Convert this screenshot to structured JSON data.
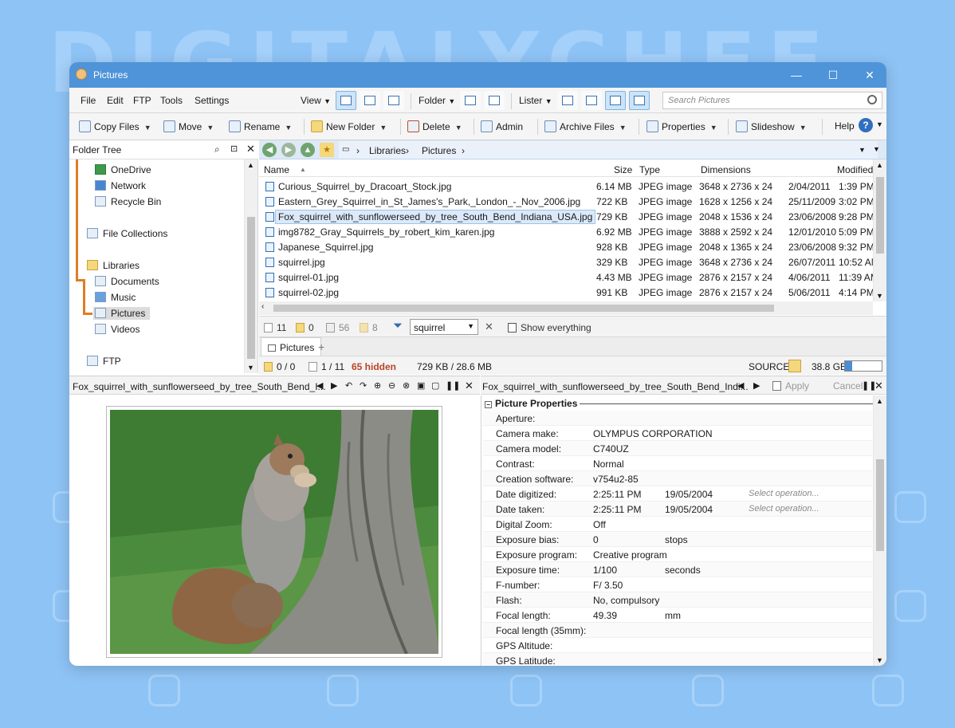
{
  "background": {
    "brand": "DIGITALYCHEF",
    "color": "#8ec3f5"
  },
  "window": {
    "title": "Pictures",
    "accent": "#4f93d8"
  },
  "menu": {
    "file": "File",
    "edit": "Edit",
    "ftp": "FTP",
    "tools": "Tools",
    "settings": "Settings",
    "view": "View",
    "folder": "Folder",
    "lister": "Lister",
    "search_placeholder": "Search Pictures"
  },
  "toolbar": {
    "copy": "Copy Files",
    "move": "Move",
    "rename": "Rename",
    "new_folder": "New Folder",
    "delete": "Delete",
    "admin": "Admin",
    "archive": "Archive Files",
    "properties": "Properties",
    "slideshow": "Slideshow",
    "help": "Help"
  },
  "tree": {
    "title": "Folder Tree",
    "items": [
      "OneDrive",
      "Network",
      "Recycle Bin",
      "File Collections",
      "Libraries",
      "Documents",
      "Music",
      "Pictures",
      "Videos",
      "FTP"
    ]
  },
  "address": {
    "crumbs": [
      "Libraries",
      "Pictures"
    ]
  },
  "columns": {
    "name": "Name",
    "size": "Size",
    "type": "Type",
    "dimensions": "Dimensions",
    "modified": "Modified"
  },
  "files": [
    {
      "name": "Curious_Squirrel_by_Dracoart_Stock.jpg",
      "size": "6.14 MB",
      "type": "JPEG image",
      "dim": "3648 x 2736 x 24",
      "date": "2/04/2011",
      "time": "1:39 PM"
    },
    {
      "name": "Eastern_Grey_Squirrel_in_St_James's_Park,_London_-_Nov_2006.jpg",
      "size": "722 KB",
      "type": "JPEG image",
      "dim": "1628 x 1256 x 24",
      "date": "25/11/2009",
      "time": "3:02 PM"
    },
    {
      "name": "Fox_squirrel_with_sunflowerseed_by_tree_South_Bend_Indiana_USA.jpg",
      "size": "729 KB",
      "type": "JPEG image",
      "dim": "2048 x 1536 x 24",
      "date": "23/06/2008",
      "time": "9:28 PM"
    },
    {
      "name": "img8782_Gray_Squirrels_by_robert_kim_karen.jpg",
      "size": "6.92 MB",
      "type": "JPEG image",
      "dim": "3888 x 2592 x 24",
      "date": "12/01/2010",
      "time": "5:09 PM"
    },
    {
      "name": "Japanese_Squirrel.jpg",
      "size": "928 KB",
      "type": "JPEG image",
      "dim": "2048 x 1365 x 24",
      "date": "23/06/2008",
      "time": "9:32 PM"
    },
    {
      "name": "squirrel.jpg",
      "size": "329 KB",
      "type": "JPEG image",
      "dim": "3648 x 2736 x 24",
      "date": "26/07/2011",
      "time": "10:52 AM"
    },
    {
      "name": "squirrel-01.jpg",
      "size": "4.43 MB",
      "type": "JPEG image",
      "dim": "2876 x 2157 x 24",
      "date": "4/06/2011",
      "time": "11:39 AM"
    },
    {
      "name": "squirrel-02.jpg",
      "size": "991 KB",
      "type": "JPEG image",
      "dim": "2876 x 2157 x 24",
      "date": "5/06/2011",
      "time": "4:14 PM"
    }
  ],
  "filter": {
    "files": "11",
    "folders": "0",
    "hidden_files": "56",
    "hidden_folders": "8",
    "value": "squirrel",
    "show_everything": "Show everything"
  },
  "tab": {
    "label": "Pictures",
    "add": "+"
  },
  "status": {
    "folders": "0 / 0",
    "files": "1 / 11",
    "hidden": "65 hidden",
    "size": "729 KB / 28.6 MB",
    "source": "SOURCE",
    "free": "38.8 GB",
    "disk_used_fraction": 0.2
  },
  "viewer": {
    "filename": "Fox_squirrel_with_sunflowerseed_by_tree_South_Bend_I...",
    "meta_filename": "Fox_squirrel_with_sunflowerseed_by_tree_South_Bend_Indi...",
    "apply": "Apply",
    "cancel": "Cancel"
  },
  "properties": {
    "title": "Picture Properties",
    "rows": [
      {
        "k": "Aperture:",
        "v": "",
        "v2": "",
        "v3": ""
      },
      {
        "k": "Camera make:",
        "v": "OLYMPUS CORPORATION",
        "v2": "",
        "v3": ""
      },
      {
        "k": "Camera model:",
        "v": "C740UZ",
        "v2": "",
        "v3": ""
      },
      {
        "k": "Contrast:",
        "v": "Normal",
        "v2": "",
        "v3": ""
      },
      {
        "k": "Creation software:",
        "v": "v754u2-85",
        "v2": "",
        "v3": ""
      },
      {
        "k": "Date digitized:",
        "v": " 2:25:11 PM",
        "v2": "19/05/2004",
        "v3": "Select operation..."
      },
      {
        "k": "Date taken:",
        "v": " 2:25:11 PM",
        "v2": "19/05/2004",
        "v3": "Select operation..."
      },
      {
        "k": "Digital Zoom:",
        "v": "Off",
        "v2": "",
        "v3": ""
      },
      {
        "k": "Exposure bias:",
        "v": "0",
        "v2": "stops",
        "v3": ""
      },
      {
        "k": "Exposure program:",
        "v": "Creative program",
        "v2": "",
        "v3": ""
      },
      {
        "k": "Exposure time:",
        "v": "1/100",
        "v2": "seconds",
        "v3": ""
      },
      {
        "k": "F-number:",
        "v": "F/  3.50",
        "v2": "",
        "v3": ""
      },
      {
        "k": "Flash:",
        "v": "No, compulsory",
        "v2": "",
        "v3": ""
      },
      {
        "k": "Focal length:",
        "v": "49.39",
        "v2": "mm",
        "v3": ""
      },
      {
        "k": "Focal length (35mm):",
        "v": "",
        "v2": "",
        "v3": ""
      },
      {
        "k": "GPS Altitude:",
        "v": "",
        "v2": "",
        "v3": ""
      },
      {
        "k": "GPS Latitude:",
        "v": "",
        "v2": "",
        "v3": ""
      }
    ]
  }
}
